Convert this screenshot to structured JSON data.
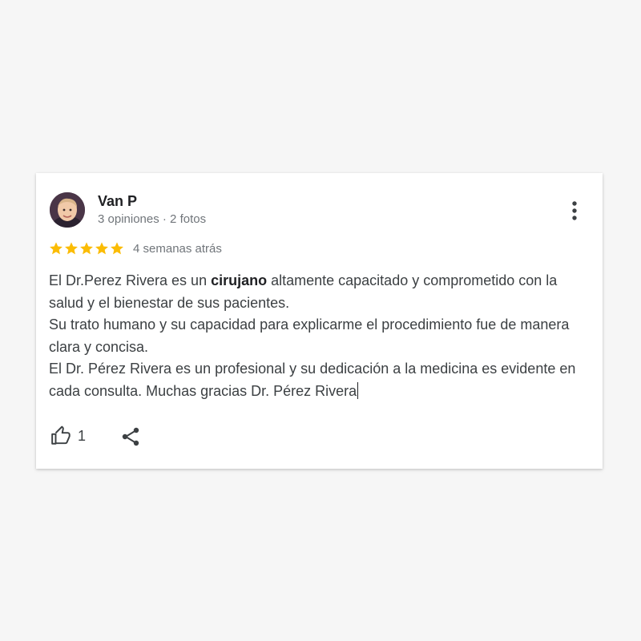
{
  "review": {
    "author": "Van P",
    "author_meta": "3 opiniones · 2 fotos",
    "rating": 5,
    "rating_max": 5,
    "time_ago": "4 semanas atrás",
    "text": {
      "line1_before": "El Dr.Perez Rivera es un ",
      "line1_bold": "cirujano",
      "line1_after": " altamente capacitado y comprometido con la salud y el bienestar de sus pacientes.",
      "line2": "Su trato humano y su capacidad para explicarme el procedimiento fue de manera clara y concisa.",
      "line3": "El Dr. Pérez Rivera es un profesional y su dedicación a la medicina es evidente en cada consulta. Muchas gracias Dr. Pérez Rivera"
    },
    "likes": "1"
  },
  "icons": {
    "avatar": "profile-photo",
    "more": "more-vert-icon",
    "star": "star-icon",
    "like": "thumb-up-outline-icon",
    "share": "share-icon"
  },
  "colors": {
    "star": "#fbbc04",
    "text": "#3c4043",
    "secondary": "#70757a",
    "background": "#f6f6f6",
    "card": "#ffffff"
  }
}
